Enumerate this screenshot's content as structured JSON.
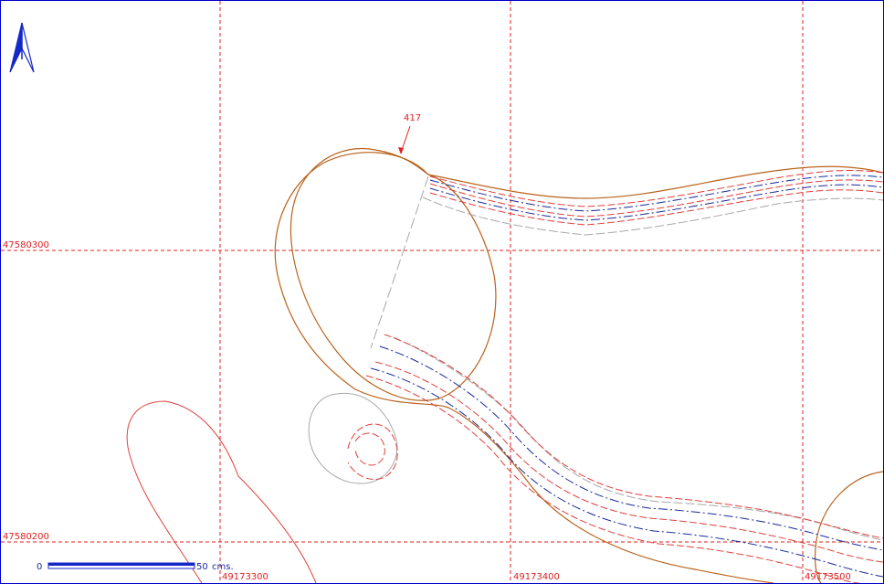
{
  "map": {
    "colors": {
      "grid": "#e02020",
      "contour_brown": "#b8621b",
      "contour_red": "#e0403c",
      "contour_blue": "#1a2a9c",
      "contour_gray": "#a8a8a8",
      "north_arrow": "#1428c8",
      "frame": "#0000c8"
    },
    "north_arrow_icon": "north-arrow-icon",
    "feature_label": "417",
    "grid_labels": {
      "x": [
        "49173300",
        "49173400",
        "49173500"
      ],
      "y": [
        "47580300",
        "47580200"
      ]
    },
    "scale_bar": {
      "start_label": "0",
      "end_label": "50",
      "unit": "cms."
    }
  }
}
